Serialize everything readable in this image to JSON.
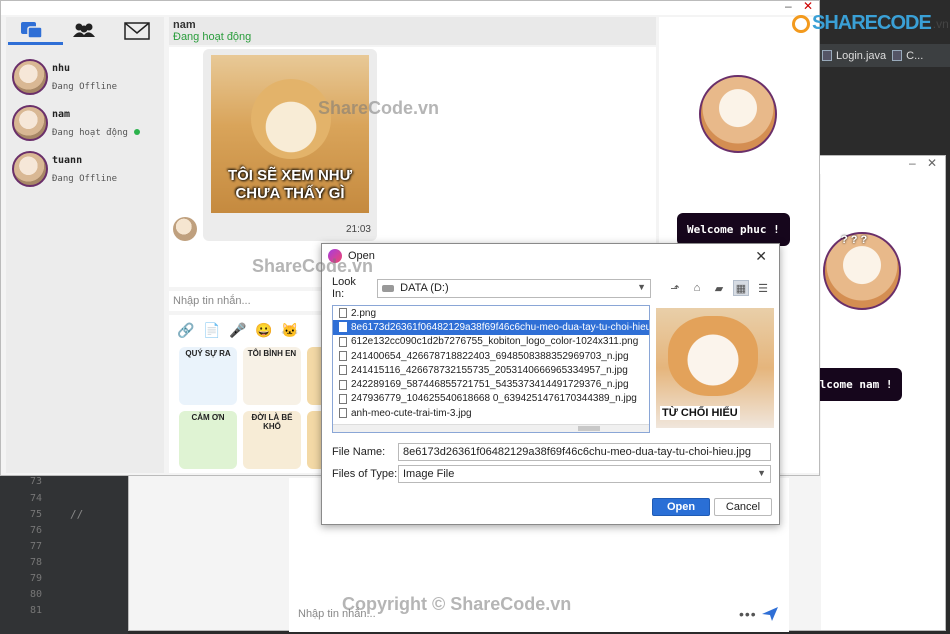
{
  "ide": {
    "tabs": [
      "Login.java",
      "C..."
    ],
    "line_numbers": [
      "73",
      "74",
      "75",
      "76",
      "77",
      "78",
      "79",
      "80",
      "81"
    ],
    "comment": "//"
  },
  "back_window": {
    "welcome": "elcome nam !",
    "input_placeholder": "Nhập tin nhắn..."
  },
  "front_window": {
    "contacts": [
      {
        "name": "nhu",
        "status": "Đang Offline"
      },
      {
        "name": "nam",
        "status": "Đang hoạt động",
        "online": true
      },
      {
        "name": "tuann",
        "status": "Đang Offline"
      }
    ],
    "chat": {
      "name": "nam",
      "status": "Đang hoạt động",
      "sticker_text": "TÔI SẼ XEM NHƯ CHƯA THẤY GÌ",
      "time": "21:03"
    },
    "input_placeholder": "Nhập tin nhắn...",
    "stickers": [
      "QUÝ SỰ RA",
      "TÔI BÌNH EN",
      "CẢM ƠN",
      "ĐỜI LÀ BỂ KHỔ"
    ],
    "welcome": "Welcome phuc !",
    "avatar_caption": "? ? ?"
  },
  "dialog": {
    "title": "Open",
    "look_in_label": "Look In:",
    "look_in_value": "DATA  (D:)",
    "files": [
      "2.png",
      "8e6173d26361f06482129a38f69f46c6chu-meo-dua-tay-tu-choi-hieu.jpg",
      "612e132cc090c1d2b7276755_kobiton_logo_color-1024x311.png",
      "241400654_426678718822403_6948508388352969703_n.jpg",
      "241415116_426678732155735_2053140666965334957_n.jpg",
      "242289169_587446855721751_5435373414491729376_n.jpg",
      "247936779_104625540618668 0_6394251476170344389_n.jpg",
      "anh-meo-cute-trai-tim-3.jpg"
    ],
    "selected_index": 1,
    "preview_caption": "TỪ CHỐI HIỂU",
    "file_name_label": "File Name:",
    "file_name_value": "8e6173d26361f06482129a38f69f46c6chu-meo-dua-tay-tu-choi-hieu.jpg",
    "file_type_label": "Files of Type:",
    "file_type_value": "Image File",
    "open_button": "Open",
    "cancel_button": "Cancel"
  },
  "watermarks": {
    "top": "ShareCode.vn",
    "middle": "ShareCode.vn",
    "bottom": "Copyright © ShareCode.vn"
  },
  "logo": {
    "text": "SHARECODE",
    "suffix": ".vn"
  },
  "colors": {
    "accent": "#2f6fd6",
    "online": "#2bb24c",
    "pill": "#16061c",
    "avatar_border": "#6a2f6a"
  }
}
